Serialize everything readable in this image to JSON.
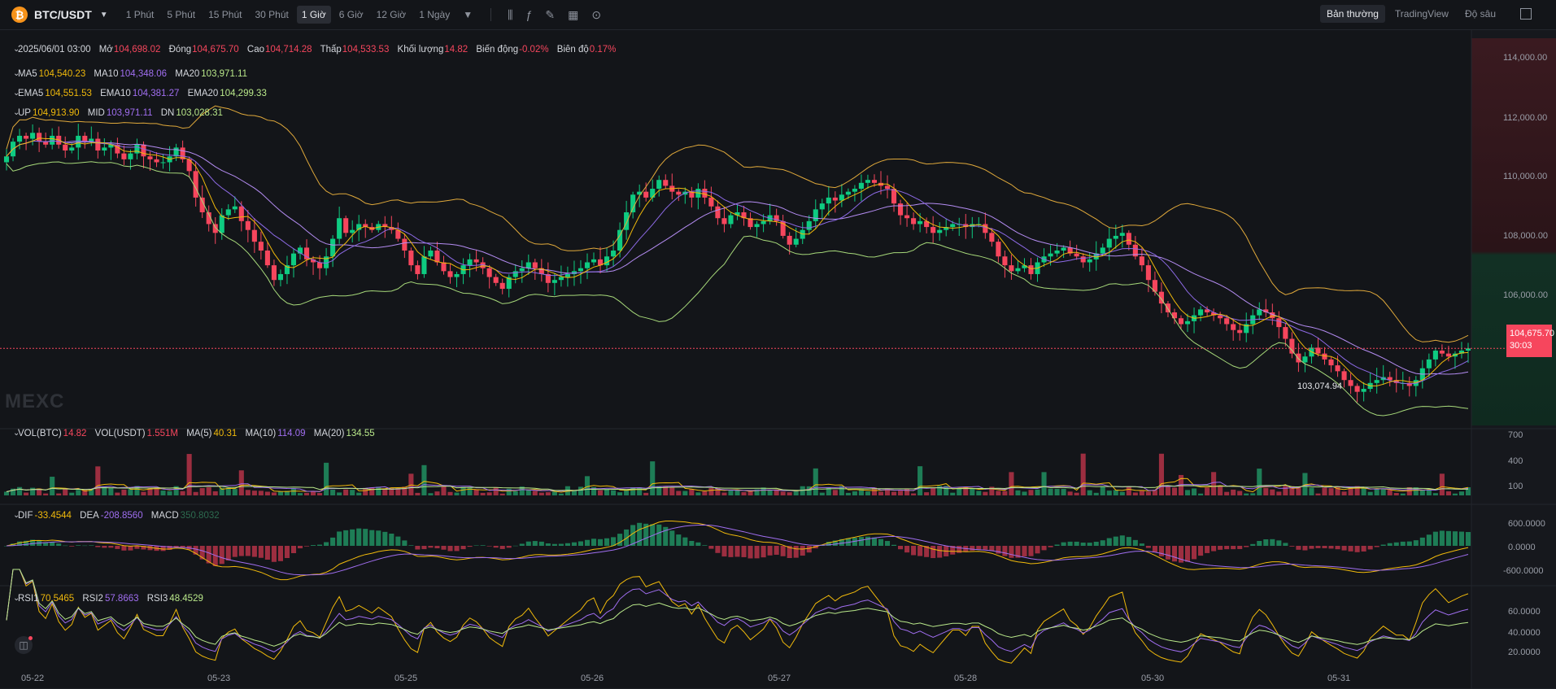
{
  "header": {
    "symbol": "BTC/USDT",
    "coin_glyph": "₿",
    "timeframes": [
      "1 Phút",
      "5 Phút",
      "15 Phút",
      "30 Phút",
      "1 Giờ",
      "6 Giờ",
      "12 Giờ",
      "1 Ngày"
    ],
    "active_timeframe": "1 Giờ",
    "view_modes": [
      "Bản thường",
      "TradingView",
      "Độ sâu"
    ],
    "active_view": "Bản thường"
  },
  "ohlc": {
    "date": "2025/06/01 03:00",
    "open_label": "Mở",
    "open": "104,698.02",
    "close_label": "Đóng",
    "close": "104,675.70",
    "high_label": "Cao",
    "high": "104,714.28",
    "low_label": "Thấp",
    "low": "104,533.53",
    "volume_label": "Khối lượng",
    "volume": "14.82",
    "change_label": "Biến động",
    "change": "-0.02%",
    "amplitude_label": "Biên độ",
    "amplitude": "0.17%"
  },
  "ma": {
    "ma5_label": "MA5",
    "ma5": "104,540.23",
    "ma10_label": "MA10",
    "ma10": "104,348.06",
    "ma20_label": "MA20",
    "ma20": "103,971.11"
  },
  "ema": {
    "ema5_label": "EMA5",
    "ema5": "104,551.53",
    "ema10_label": "EMA10",
    "ema10": "104,381.27",
    "ema20_label": "EMA20",
    "ema20": "104,299.33"
  },
  "boll": {
    "up_label": "UP",
    "up": "104,913.90",
    "mid_label": "MID",
    "mid": "103,971.11",
    "dn_label": "DN",
    "dn": "103,028.31"
  },
  "vol": {
    "btc_label": "VOL(BTC)",
    "btc": "14.82",
    "usdt_label": "VOL(USDT)",
    "usdt": "1.551M",
    "ma5_label": "MA(5)",
    "ma5": "40.31",
    "ma10_label": "MA(10)",
    "ma10": "114.09",
    "ma20_label": "MA(20)",
    "ma20": "134.55"
  },
  "macd": {
    "dif_label": "DIF",
    "dif": "-33.4544",
    "dea_label": "DEA",
    "dea": "-208.8560",
    "macd_label": "MACD",
    "macd": "350.8032"
  },
  "rsi": {
    "rsi1_label": "RSI1",
    "rsi1": "70.5465",
    "rsi2_label": "RSI2",
    "rsi2": "57.8663",
    "rsi3_label": "RSI3",
    "rsi3": "48.4529"
  },
  "price_axis": [
    "114,000.00",
    "112,000.00",
    "110,000.00",
    "108,000.00",
    "106,000.00"
  ],
  "current_price": "104,675.70",
  "countdown": "30:03",
  "low_marker": "103,074.94",
  "watermark": "MEXC",
  "vol_axis": [
    "700",
    "400",
    "100"
  ],
  "macd_axis": [
    "600.0000",
    "0.0000",
    "-600.0000"
  ],
  "rsi_axis": [
    "60.0000",
    "40.0000",
    "20.0000"
  ],
  "dates": [
    "05-22",
    "05-23",
    "05-25",
    "05-26",
    "05-27",
    "05-28",
    "05-30",
    "05-31"
  ],
  "colors": {
    "up": "#0ecb81",
    "down": "#f6465d",
    "ma5": "#f0b90b",
    "ma10": "#a06ef0",
    "ma20": "#b9e88a",
    "bg": "#131519"
  },
  "chart_data": {
    "type": "candlestick",
    "close_series": [
      111200,
      111700,
      111900,
      111800,
      112000,
      111700,
      111600,
      111900,
      111600,
      111400,
      111500,
      111900,
      111700,
      111800,
      111400,
      111500,
      111600,
      111300,
      111100,
      111300,
      111600,
      111200,
      111100,
      111000,
      111000,
      111200,
      111500,
      111100,
      110700,
      109800,
      109300,
      108900,
      108600,
      109200,
      109400,
      109500,
      109000,
      108700,
      108300,
      108000,
      107500,
      107000,
      107200,
      107500,
      107900,
      108100,
      107700,
      107600,
      107400,
      107800,
      108400,
      109100,
      108600,
      108700,
      108900,
      108800,
      108700,
      108900,
      108800,
      108700,
      108400,
      108000,
      107500,
      107200,
      107800,
      108000,
      107600,
      107300,
      107100,
      107200,
      107500,
      107700,
      107600,
      107400,
      107100,
      106900,
      106700,
      107100,
      107300,
      107400,
      107600,
      107400,
      107200,
      106900,
      107000,
      107100,
      107200,
      107300,
      107400,
      107600,
      107700,
      107500,
      107800,
      108000,
      108700,
      109300,
      109900,
      110000,
      109800,
      110100,
      110400,
      110200,
      110000,
      109900,
      110000,
      109800,
      110100,
      109800,
      109500,
      109100,
      108900,
      109200,
      109300,
      109100,
      108800,
      108900,
      109000,
      109200,
      109000,
      108500,
      108200,
      108400,
      108700,
      109000,
      109400,
      109600,
      109800,
      109700,
      109900,
      110000,
      110100,
      110300,
      110400,
      110300,
      110200,
      110100,
      109600,
      109200,
      109100,
      108900,
      109000,
      108800,
      108600,
      108700,
      108800,
      108900,
      108900,
      108800,
      108900,
      108900,
      108600,
      108300,
      107800,
      107500,
      107300,
      107400,
      107500,
      107200,
      107600,
      107800,
      107900,
      108000,
      108100,
      107900,
      107800,
      107600,
      107700,
      107900,
      108100,
      108400,
      108500,
      108600,
      108200,
      107800,
      107500,
      107000,
      106600,
      106200,
      105900,
      105700,
      105500,
      105600,
      105800,
      106000,
      105900,
      105800,
      105700,
      105500,
      105300,
      105200,
      105500,
      105800,
      106000,
      105900,
      105700,
      105400,
      105000,
      104500,
      104200,
      104400,
      104700,
      104500,
      104300,
      104100,
      103900,
      103600,
      103400,
      103200,
      103300,
      103500,
      103600,
      103700,
      103600,
      103500,
      103500,
      103400,
      103600,
      104000,
      104300,
      104600,
      104500,
      104400,
      104500,
      104600,
      104700
    ]
  }
}
